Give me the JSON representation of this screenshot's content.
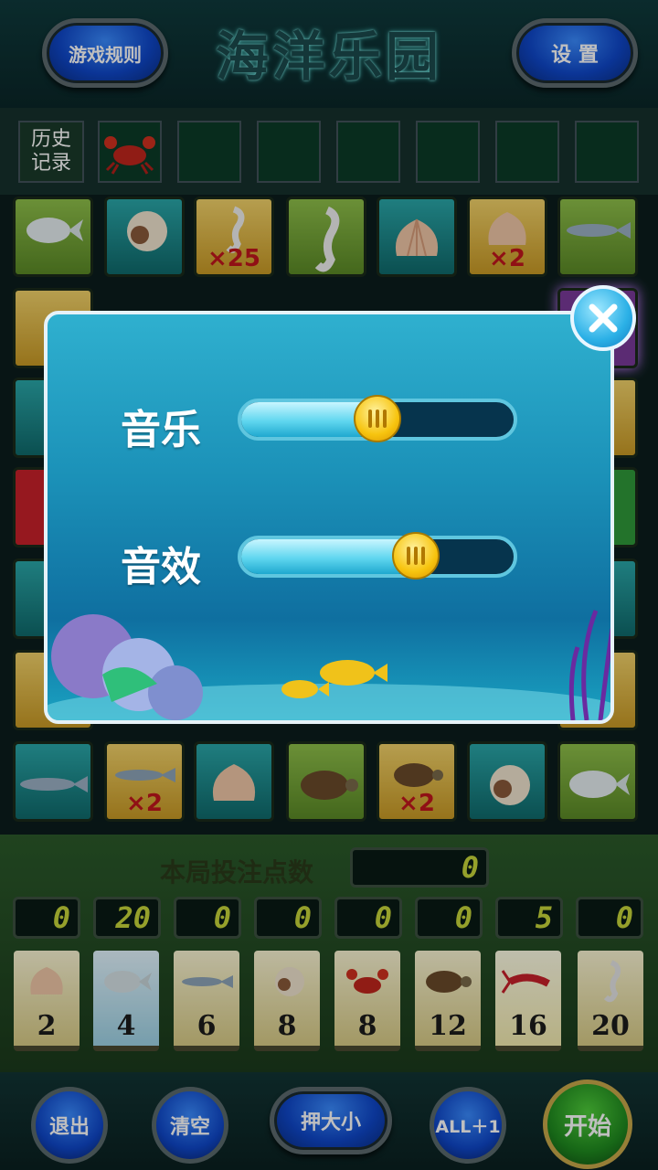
{
  "header": {
    "rules_button": "游戏规则",
    "title": "海洋乐园",
    "settings_button": "设 置"
  },
  "history": {
    "label": "历史记录",
    "records": [
      "crab",
      "",
      "",
      "",
      "",
      "",
      ""
    ]
  },
  "board": {
    "top_row": [
      {
        "icon": "pomfret-fish",
        "mult": ""
      },
      {
        "icon": "nautilus-shell",
        "mult": ""
      },
      {
        "icon": "seahorse",
        "mult": "×25"
      },
      {
        "icon": "seahorse",
        "mult": ""
      },
      {
        "icon": "scallop-shell",
        "mult": ""
      },
      {
        "icon": "scallop-shell",
        "mult": "×2"
      },
      {
        "icon": "mackerel-fish",
        "mult": ""
      }
    ],
    "bottom_row": [
      {
        "icon": "mackerel-fish",
        "mult": ""
      },
      {
        "icon": "mackerel-fish",
        "mult": "×2"
      },
      {
        "icon": "scallop-shell",
        "mult": ""
      },
      {
        "icon": "turtle",
        "mult": ""
      },
      {
        "icon": "turtle",
        "mult": "×2"
      },
      {
        "icon": "nautilus-shell",
        "mult": ""
      },
      {
        "icon": "pomfret-fish",
        "mult": ""
      }
    ]
  },
  "betting": {
    "label": "本局投注点数",
    "total": "0",
    "counters": [
      "0",
      "20",
      "0",
      "0",
      "0",
      "0",
      "5",
      "0"
    ],
    "cards": [
      {
        "icon": "scallop-shell",
        "odds": "2"
      },
      {
        "icon": "pomfret-fish",
        "odds": "4"
      },
      {
        "icon": "mackerel-fish",
        "odds": "6"
      },
      {
        "icon": "nautilus-shell",
        "odds": "8"
      },
      {
        "icon": "crab",
        "odds": "8"
      },
      {
        "icon": "turtle",
        "odds": "12"
      },
      {
        "icon": "lobster",
        "odds": "16"
      },
      {
        "icon": "seahorse",
        "odds": "20"
      }
    ]
  },
  "controls": {
    "exit": "退出",
    "clear": "清空",
    "big_small": "押大小",
    "all_plus_one": "ALL＋1",
    "start": "开始"
  },
  "settings_dialog": {
    "music_label": "音乐",
    "music_level": 0.5,
    "sfx_label": "音效",
    "sfx_level": 0.67
  }
}
